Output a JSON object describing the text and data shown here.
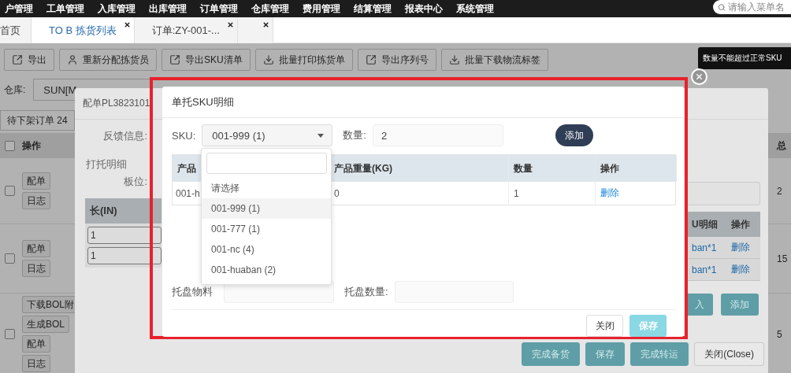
{
  "top_nav": {
    "items": [
      "户管理",
      "工单管理",
      "入库管理",
      "出库管理",
      "订单管理",
      "仓库管理",
      "费用管理",
      "结算管理",
      "报表中心",
      "系统管理"
    ],
    "search": {
      "placeholder": "请输入菜单名"
    }
  },
  "page_tabs": [
    {
      "label": "首页",
      "selected": false,
      "closable": false
    },
    {
      "label": "TO B 拣货列表",
      "selected": true,
      "closable": true
    },
    {
      "label": "订单:ZY-001-...",
      "selected": false,
      "closable": true
    },
    {
      "selected": false,
      "closable": true
    }
  ],
  "toolbar": [
    {
      "label": "导出",
      "kind": "export"
    },
    {
      "label": "重新分配拣货员",
      "kind": "user"
    },
    {
      "label": "导出SKU清单",
      "kind": "export"
    },
    {
      "label": "批量打印拣货单",
      "kind": "download"
    },
    {
      "label": "导出序列号",
      "kind": "export"
    },
    {
      "label": "批量下载物流标签",
      "kind": "download"
    }
  ],
  "filters": {
    "warehouse_label": "仓库:",
    "warehouse_value": "SUN[M"
  },
  "list_tabs": [
    {
      "label": "待下架订单 24",
      "selected": true
    }
  ],
  "orders_table": {
    "all_checked": false,
    "columns": [
      "操作"
    ],
    "side_column": "总",
    "rows": [
      {
        "checked": false,
        "actions": [
          "配单",
          "日志"
        ],
        "side_value": "2"
      },
      {
        "checked": false,
        "actions": [
          "配单",
          "日志"
        ],
        "side_value": "15"
      },
      {
        "checked": false,
        "actions": [
          "下载BOL附",
          "生成BOL",
          "配单",
          "日志"
        ],
        "side_value": "5"
      }
    ]
  },
  "allocation_dialog": {
    "title": "配单PL3823101",
    "feedback_label": "反馈信息:",
    "section": "打托明细",
    "slot_label": "板位:",
    "pallet_table": {
      "columns": [
        "长(IN)",
        "U明细",
        "操作"
      ],
      "rows": [
        {
          "length": "1",
          "sku_detail": "ban*1",
          "action": "删除"
        },
        {
          "length": "1",
          "sku_detail": "ban*1",
          "action": "删除"
        }
      ]
    },
    "table_buttons": [
      "入",
      "添加"
    ],
    "footer_buttons": [
      {
        "label": "完成备货",
        "kind": "primary"
      },
      {
        "label": "保存",
        "kind": "primary"
      },
      {
        "label": "完成转运",
        "kind": "primary"
      },
      {
        "label": "关闭(Close)",
        "kind": "default"
      }
    ]
  },
  "sku_dialog": {
    "title": "单托SKU明细",
    "sku_label": "SKU:",
    "sku_value": "001-999 (1)",
    "qty_label": "数量:",
    "qty_value": "2",
    "add_button": "添加",
    "table": {
      "columns": [
        "产品",
        "产品重量(KG)",
        "数量",
        "操作"
      ],
      "rows": [
        {
          "product": "001-h",
          "weight": "0",
          "qty": "1",
          "action": "删除"
        }
      ]
    },
    "material_label": "托盘物料",
    "pallet_qty_label": "托盘数量:",
    "footer_buttons": [
      {
        "label": "关闭",
        "kind": "default",
        "disabled": false
      },
      {
        "label": "保存",
        "kind": "primary",
        "disabled": true
      }
    ]
  },
  "sku_dropdown": {
    "options": [
      {
        "label": "请选择",
        "selected": false
      },
      {
        "label": "001-999 (1)",
        "selected": true
      },
      {
        "label": "001-777 (1)",
        "selected": false
      },
      {
        "label": "001-nc (4)",
        "selected": false
      },
      {
        "label": "001-huaban (2)",
        "selected": false
      }
    ]
  },
  "toast": {
    "text": "数量不能超过正常SKU"
  }
}
